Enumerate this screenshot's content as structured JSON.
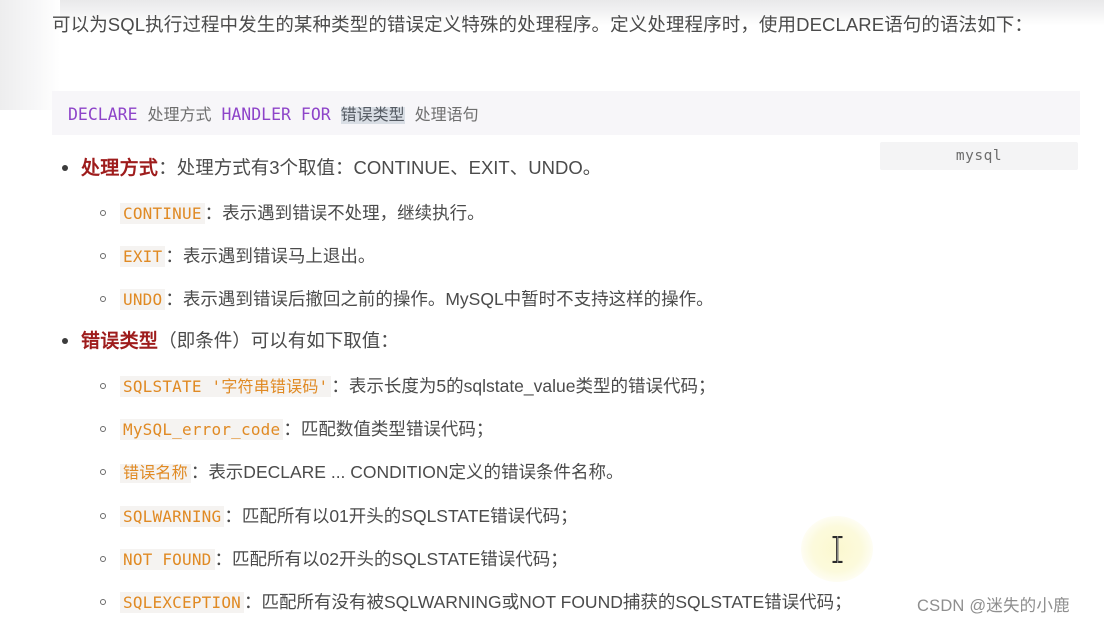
{
  "document": {
    "intro_paragraph": "可以为SQL执行过程中发生的某种类型的错误定义特殊的处理程序。定义处理程序时，使用DECLARE语句的语法如下：",
    "code_block": {
      "language_label": "mysql",
      "tokens": {
        "kw_declare": "DECLARE",
        "arg_handler_action": "处理方式",
        "kw_handler": "HANDLER",
        "kw_for": "FOR",
        "arg_error_type_selected": "错误类型",
        "arg_statement": "处理语句"
      }
    },
    "bullets": [
      {
        "term": "处理方式",
        "separator": "：",
        "description": "处理方式有3个取值：CONTINUE、EXIT、UNDO。",
        "children": [
          {
            "code": "CONTINUE",
            "separator": "：",
            "description": "表示遇到错误不处理，继续执行。"
          },
          {
            "code": "EXIT",
            "separator": "：",
            "description": "表示遇到错误马上退出。"
          },
          {
            "code": "UNDO",
            "separator": "：",
            "description": "表示遇到错误后撤回之前的操作。MySQL中暂时不支持这样的操作。"
          }
        ]
      },
      {
        "term": "错误类型",
        "separator": "",
        "description": "（即条件）可以有如下取值：",
        "children": [
          {
            "code": "SQLSTATE '字符串错误码'",
            "separator": "：",
            "description": "表示长度为5的sqlstate_value类型的错误代码；"
          },
          {
            "code": "MySQL_error_code",
            "separator": "：",
            "description": "匹配数值类型错误代码；"
          },
          {
            "code": "错误名称",
            "separator": "：",
            "description": "表示DECLARE ... CONDITION定义的错误条件名称。"
          },
          {
            "code": "SQLWARNING",
            "separator": "：",
            "description": "匹配所有以01开头的SQLSTATE错误代码；"
          },
          {
            "code": "NOT FOUND",
            "separator": "：",
            "description": "匹配所有以02开头的SQLSTATE错误代码；"
          },
          {
            "code": "SQLEXCEPTION",
            "separator": "：",
            "description": "匹配所有没有被SQLWARNING或NOT FOUND捕获的SQLSTATE错误代码；"
          }
        ]
      }
    ],
    "watermark": "CSDN @迷失的小鹿",
    "cursor": {
      "type": "text-ibeam"
    },
    "colors": {
      "keyword_purple": "#8e44c9",
      "term_red": "#9e1c1c",
      "code_orange": "#e08a24",
      "body_text": "#4b4b4b",
      "code_bg": "#f7f6f9",
      "inline_code_bg": "#f5f3f1",
      "selection_bg": "#d9dee5"
    }
  }
}
